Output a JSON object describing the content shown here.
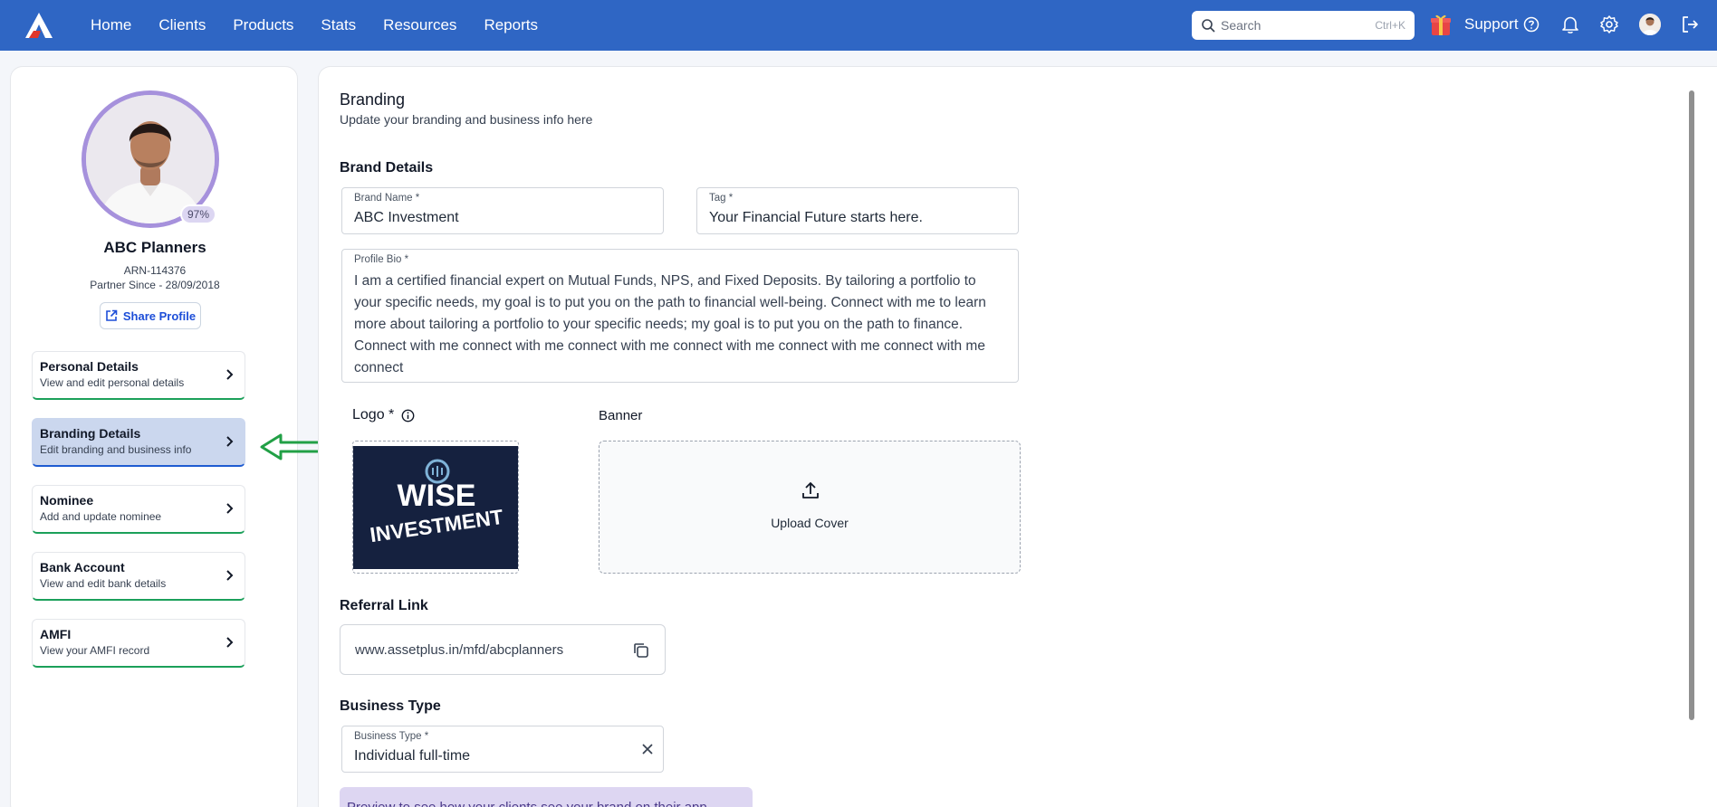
{
  "nav": {
    "items": [
      "Home",
      "Clients",
      "Products",
      "Stats",
      "Resources",
      "Reports"
    ],
    "search_placeholder": "Search",
    "search_shortcut": "Ctrl+K",
    "support_label": "Support"
  },
  "profile": {
    "name": "ABC Planners",
    "arn": "ARN-114376",
    "partner_since": "Partner Since - 28/09/2018",
    "completion": "97%",
    "share_label": "Share Profile"
  },
  "menu": [
    {
      "title": "Personal Details",
      "subtitle": "View and edit personal details"
    },
    {
      "title": "Branding Details",
      "subtitle": "Edit branding and business info"
    },
    {
      "title": "Nominee",
      "subtitle": "Add and update nominee"
    },
    {
      "title": "Bank Account",
      "subtitle": "View and edit bank details"
    },
    {
      "title": "AMFI",
      "subtitle": "View your AMFI record"
    }
  ],
  "main": {
    "title": "Branding",
    "subtitle": "Update your branding and business info here",
    "brand_details_heading": "Brand Details",
    "brand_name_label": "Brand Name *",
    "brand_name_value": "ABC Investment",
    "tag_label": "Tag *",
    "tag_value": "Your Financial Future starts here.",
    "bio_label": "Profile Bio *",
    "bio_value": "I am a certified financial expert on Mutual Funds, NPS, and Fixed Deposits. By tailoring a portfolio to your specific needs, my goal is to put you on the path to financial well-being. Connect with me to learn more about tailoring a portfolio to your specific needs; my goal is to put you on the path to finance. Connect with me connect with me connect with me connect with me connect with me connect with me connect",
    "logo_label": "Logo *",
    "logo_text_top": "WISE",
    "logo_text_bottom": "INVESTMENT",
    "banner_label": "Banner",
    "upload_cover": "Upload Cover",
    "referral_heading": "Referral Link",
    "referral_link": "www.assetplus.in/mfd/abcplanners",
    "business_type_heading": "Business Type",
    "business_type_label": "Business Type *",
    "business_type_value": "Individual full-time",
    "preview_text": "Preview to see how your clients see your brand on their app"
  },
  "colors": {
    "topbar": "#2f66c4",
    "ring": "#a691dc",
    "menu_underline": "#1ba05a",
    "active_menu": "#cbd7ee",
    "arrow": "#22a046"
  }
}
